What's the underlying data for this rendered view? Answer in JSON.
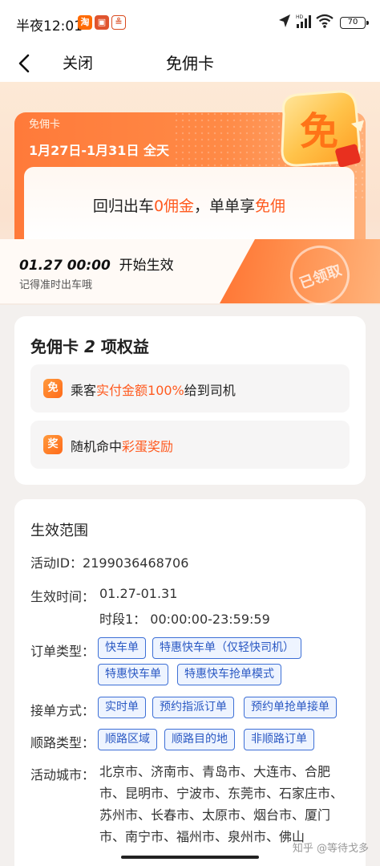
{
  "status_bar": {
    "time": "半夜12:01",
    "battery": "70",
    "signal_label": "HD"
  },
  "nav": {
    "close": "关闭",
    "title": "免佣卡"
  },
  "hero": {
    "tag": "免佣卡",
    "date": "1月27日-1月31日 全天",
    "slogan_pre": "回归出车",
    "slogan_hl1": "0佣金",
    "slogan_mid": "，单单享",
    "slogan_hl2": "免佣",
    "badge_char": "免",
    "effect_time": "01.27 00:00",
    "effect_suffix": "开始生效",
    "reminder": "记得准时出车哦",
    "claimed": "已领取"
  },
  "benefits": {
    "title_pre": "免佣卡",
    "title_num": "2",
    "title_post": "项权益",
    "items": [
      {
        "icon": "免",
        "pre": "乘客",
        "hl": "实付金额100%",
        "post": "给到司机"
      },
      {
        "icon": "奖",
        "pre": "随机命中",
        "hl": "彩蛋奖励",
        "post": ""
      }
    ]
  },
  "scope": {
    "title": "生效范围",
    "activity_id_label": "活动ID：",
    "activity_id": "2199036468706",
    "effect_label": "生效时间：",
    "effect_date": "01.27-01.31",
    "effect_slot": "时段1：  00:00:00-23:59:59",
    "order_type_label": "订单类型：",
    "order_types": [
      "快车单",
      "特惠快车单（仅轻快司机）",
      "特惠快车单",
      "特惠快车抢单模式"
    ],
    "accept_label": "接单方式：",
    "accept_modes": [
      "实时单",
      "预约指派订单",
      "预约单抢单接单"
    ],
    "route_label": "顺路类型：",
    "route_types": [
      "顺路区域",
      "顺路目的地",
      "非顺路订单"
    ],
    "city_label": "活动城市：",
    "cities": "北京市、济南市、青岛市、大连市、合肥市、昆明市、宁波市、东莞市、石家庄市、苏州市、长春市、太原市、烟台市、厦门市、南宁市、福州市、泉州市、佛山"
  },
  "watermark": "知乎 @等待戈多",
  "colors": {
    "accent": "#ff5a1f",
    "chip_border": "#3d6fd6",
    "chip_text": "#2b59c3"
  }
}
